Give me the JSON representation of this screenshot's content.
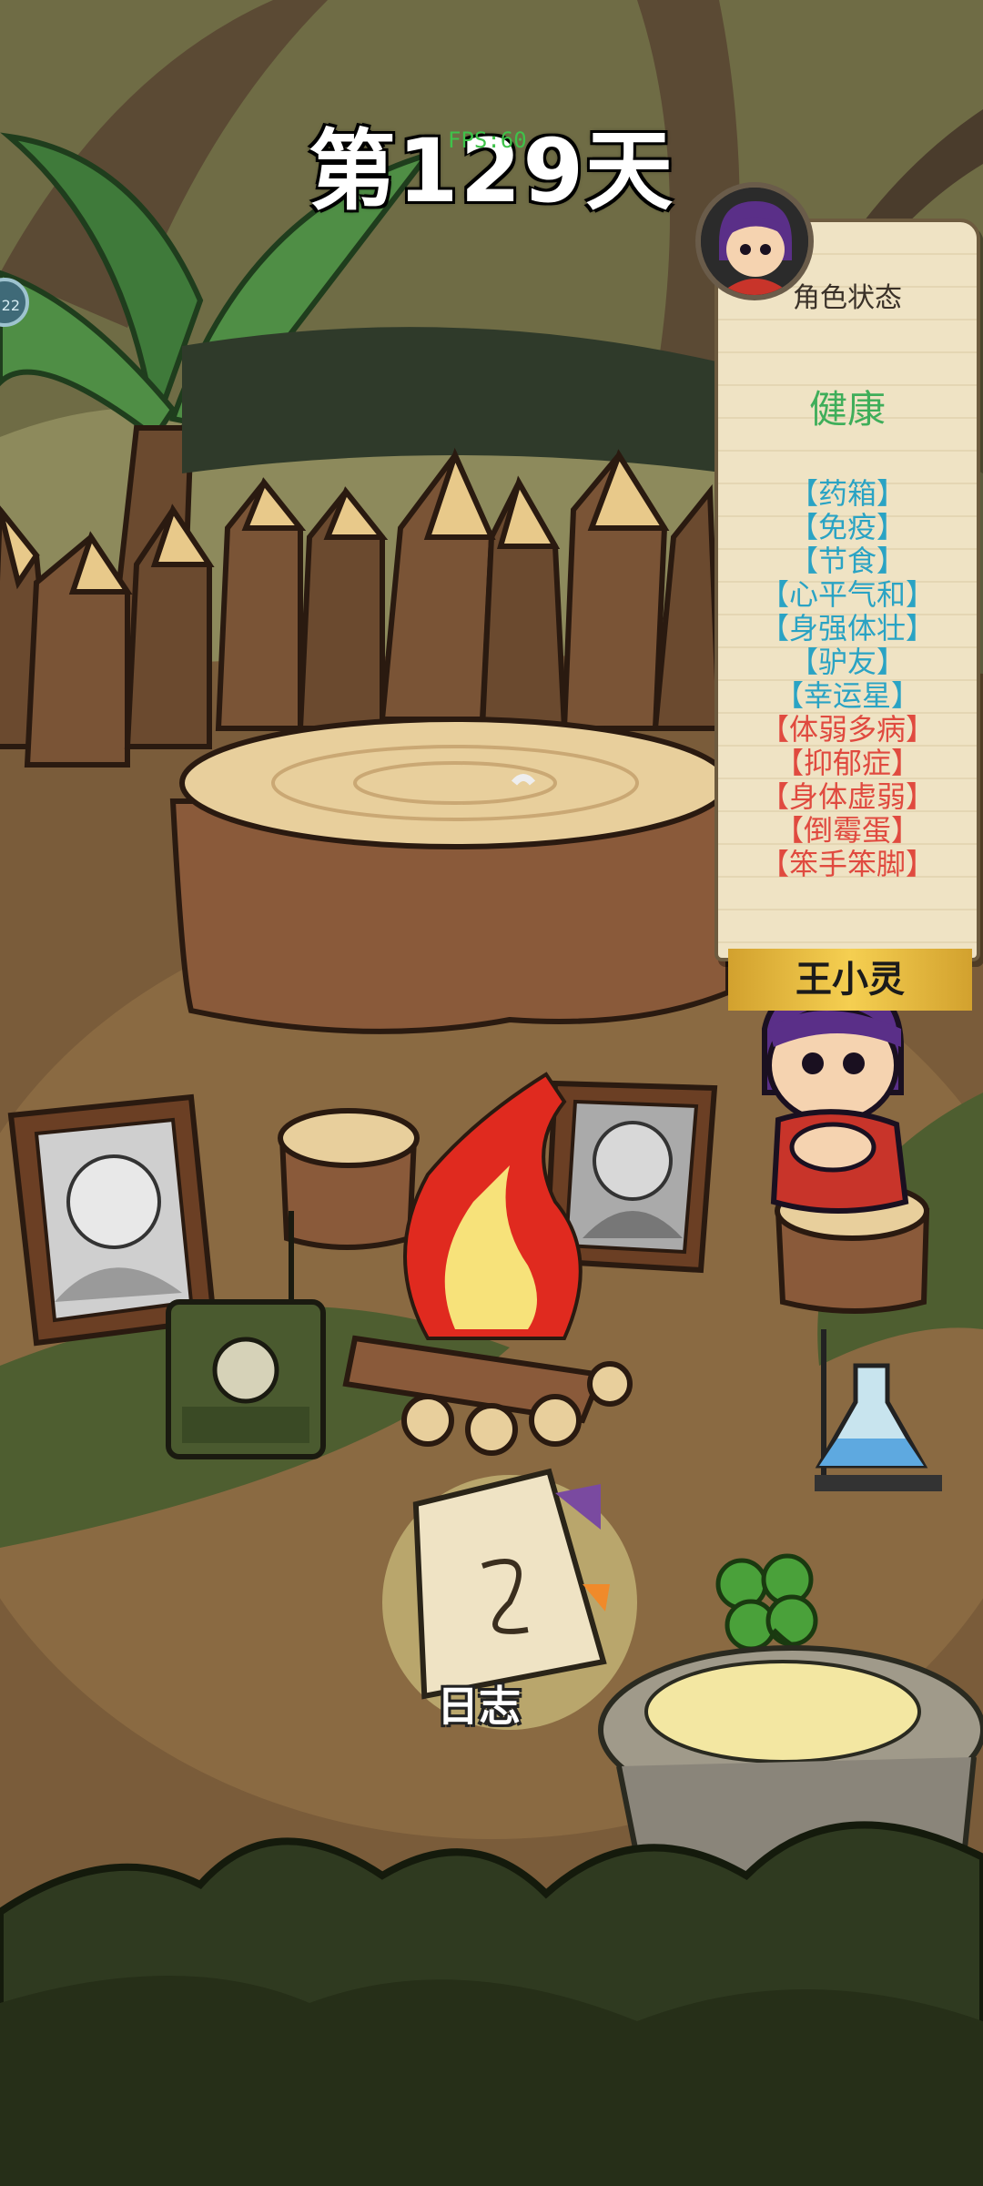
{
  "hud": {
    "day_label": "第129天",
    "fps_label": "FPS:60",
    "side_badge": "22"
  },
  "status_panel": {
    "title": "角色状态",
    "health": "健康",
    "traits": [
      {
        "label": "【药箱】",
        "color": "#2aa3c4"
      },
      {
        "label": "【免疫】",
        "color": "#2aa3c4"
      },
      {
        "label": "【节食】",
        "color": "#2aa3c4"
      },
      {
        "label": "【心平气和】",
        "color": "#2aa3c4"
      },
      {
        "label": "【身强体壮】",
        "color": "#2aa3c4"
      },
      {
        "label": "【驴友】",
        "color": "#2aa3c4"
      },
      {
        "label": "【幸运星】",
        "color": "#2aa3c4"
      },
      {
        "label": "【体弱多病】",
        "color": "#e04a3f"
      },
      {
        "label": "【抑郁症】",
        "color": "#e04a3f"
      },
      {
        "label": "【身体虚弱】",
        "color": "#e04a3f"
      },
      {
        "label": "【倒霉蛋】",
        "color": "#e04a3f"
      },
      {
        "label": "【笨手笨脚】",
        "color": "#e04a3f"
      }
    ]
  },
  "character": {
    "name": "王小灵"
  },
  "journal": {
    "label": "日志"
  }
}
